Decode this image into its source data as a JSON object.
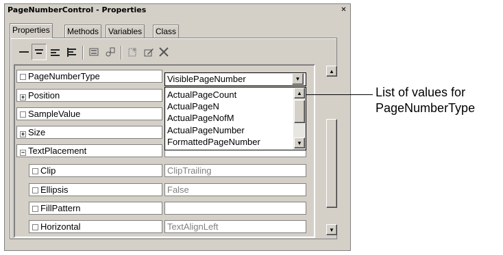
{
  "window": {
    "title": "PageNumberControl - Properties",
    "close_glyph": "✕"
  },
  "tabs": [
    {
      "label": "Properties",
      "active": true
    },
    {
      "label": "Methods",
      "active": false
    },
    {
      "label": "Variables",
      "active": false
    },
    {
      "label": "Class",
      "active": false
    }
  ],
  "toolbar": {
    "icons": [
      "align-none-icon",
      "align-center-icon",
      "align-left-icon",
      "align-justify-icon",
      "form-icon",
      "link-icon",
      "new-icon",
      "edit-icon",
      "delete-icon"
    ]
  },
  "properties": [
    {
      "name": "PageNumberType",
      "value": "VisiblePageNumber",
      "expander": "checkbox",
      "indent": false,
      "value_gray": false
    },
    {
      "name": "Position",
      "value": "",
      "expander": "plus",
      "indent": false,
      "value_gray": false
    },
    {
      "name": "SampleValue",
      "value": "",
      "expander": "checkbox",
      "indent": false,
      "value_gray": false
    },
    {
      "name": "Size",
      "value": "",
      "expander": "plus",
      "indent": false,
      "value_gray": false
    },
    {
      "name": "TextPlacement",
      "value": "",
      "expander": "minus",
      "indent": false,
      "value_gray": false
    },
    {
      "name": "Clip",
      "value": "ClipTrailing",
      "expander": "checkbox",
      "indent": true,
      "value_gray": true
    },
    {
      "name": "Ellipsis",
      "value": "False",
      "expander": "checkbox",
      "indent": true,
      "value_gray": true
    },
    {
      "name": "FillPattern",
      "value": "",
      "expander": "checkbox",
      "indent": true,
      "value_gray": true
    },
    {
      "name": "Horizontal",
      "value": "TextAlignLeft",
      "expander": "checkbox",
      "indent": true,
      "value_gray": true
    }
  ],
  "dropdown": {
    "options": [
      "ActualPageCount",
      "ActualPageN",
      "ActualPageNofM",
      "ActualPageNumber",
      "FormattedPageNumber"
    ]
  },
  "annotation": {
    "line1": "List of values for",
    "line2": "PageNumberType"
  },
  "glyphs": {
    "plus": "+",
    "minus": "−",
    "up": "▲",
    "down": "▼"
  }
}
